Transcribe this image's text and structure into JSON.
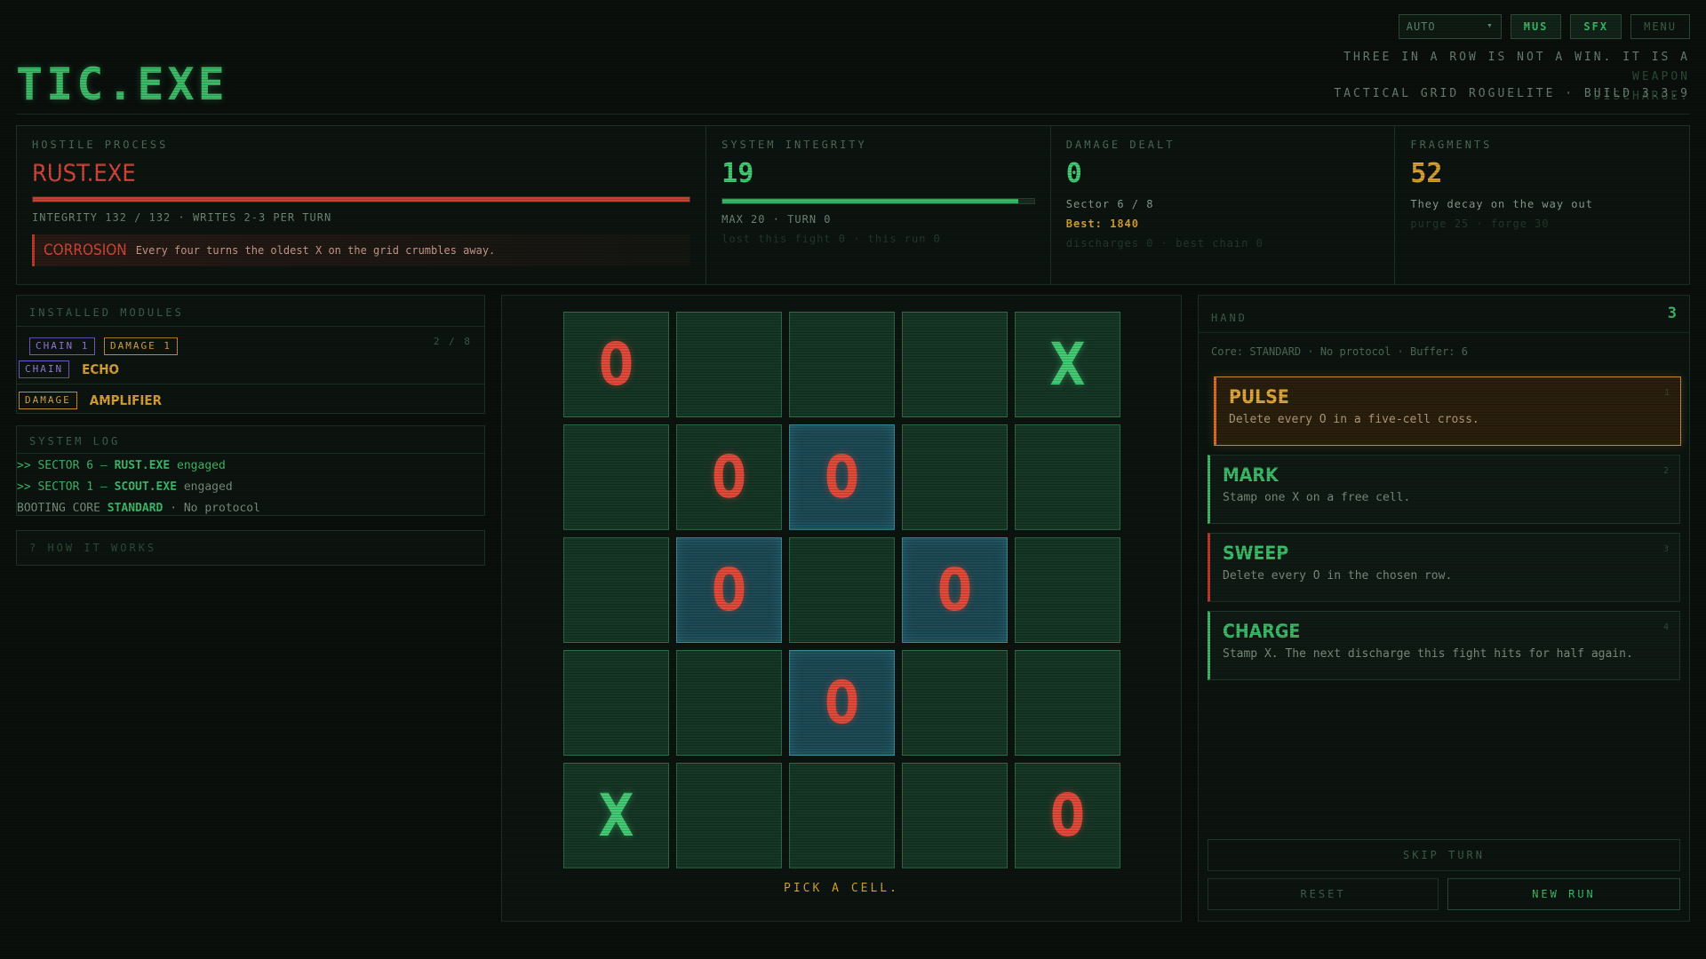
{
  "header": {
    "title": "TIC.EXE",
    "tagline_main": "THREE IN A ROW IS NOT A WIN. IT IS A",
    "tagline_hl1": "WEAPON",
    "tagline_hl2": "DISCHARGE.",
    "subtitle": "TACTICAL GRID ROGUELITE · BUILD 3.3.9",
    "controls": {
      "mode": "AUTO",
      "mus": "MUS",
      "sfx": "SFX",
      "menu": "MENU"
    }
  },
  "colors": {
    "accent_green": "#3dbb68",
    "enemy_red": "#e24a3a",
    "amber": "#d9a034",
    "highlight_cyan": "#3a8a9a"
  },
  "enemy": {
    "label": "HOSTILE PROCESS",
    "name": "RUST.EXE",
    "integrity_text": "INTEGRITY 132 / 132 · WRITES 2-3 PER TURN",
    "integrity_fraction": 1.0,
    "trait_name": "CORROSION",
    "trait_desc": "Every four turns the oldest X on the grid crumbles away."
  },
  "integrity": {
    "label": "SYSTEM INTEGRITY",
    "value": "19",
    "fraction": 0.95,
    "line1": "MAX 20 · TURN 0",
    "line2": "lost this fight 0 · this run 0"
  },
  "damage": {
    "label": "DAMAGE DEALT",
    "value": "0",
    "sector": "Sector 6 / 8",
    "best": "Best: 1840",
    "line3": "discharges 0 · best chain 0"
  },
  "fragments": {
    "label": "FRAGMENTS",
    "value": "52",
    "note": "They decay on the way out",
    "costs": "purge 25 · forge 30"
  },
  "modules": {
    "label": "INSTALLED MODULES",
    "count": "2 / 8",
    "summary_chips": [
      "CHAIN 1",
      "DAMAGE 1"
    ],
    "items": [
      {
        "tag": "CHAIN",
        "name": "ECHO"
      },
      {
        "tag": "DAMAGE",
        "name": "AMPLIFIER"
      }
    ]
  },
  "log": {
    "label": "SYSTEM LOG",
    "lines": [
      {
        "prefix": ">> SECTOR 6 — ",
        "bold": "RUST.EXE",
        "suffix": " engaged"
      },
      {
        "prefix": ">> SECTOR 1 — ",
        "bold": "SCOUT.EXE",
        "suffix": " engaged"
      },
      {
        "prefix": "BOOTING CORE ",
        "bold": "STANDARD",
        "suffix": " · No protocol"
      }
    ]
  },
  "how": {
    "label": "? HOW IT WORKS"
  },
  "board": {
    "cells": [
      [
        "O",
        "",
        "",
        "",
        "X"
      ],
      [
        "",
        "O",
        "O",
        "",
        ""
      ],
      [
        "",
        "O",
        "",
        "O",
        ""
      ],
      [
        "",
        "",
        "O",
        "",
        ""
      ],
      [
        "X",
        "",
        "",
        "",
        "O"
      ]
    ],
    "highlighted": [
      [
        1,
        2
      ],
      [
        2,
        1
      ],
      [
        2,
        3
      ],
      [
        3,
        2
      ]
    ],
    "prompt": "PICK A CELL."
  },
  "hand": {
    "label": "HAND",
    "count": "3",
    "core": "Core: STANDARD · No protocol · Buffer: 6",
    "cards": [
      {
        "title": "PULSE",
        "desc": "Delete every O in a five-cell cross.",
        "num": "1"
      },
      {
        "title": "MARK",
        "desc": "Stamp one X on a free cell.",
        "num": "2"
      },
      {
        "title": "SWEEP",
        "desc": "Delete every O in the chosen row.",
        "num": "3"
      },
      {
        "title": "CHARGE",
        "desc": "Stamp X. The next discharge this fight hits for half again.",
        "num": "4"
      }
    ],
    "skip": "SKIP TURN",
    "reset": "RESET",
    "new_run": "NEW RUN"
  }
}
